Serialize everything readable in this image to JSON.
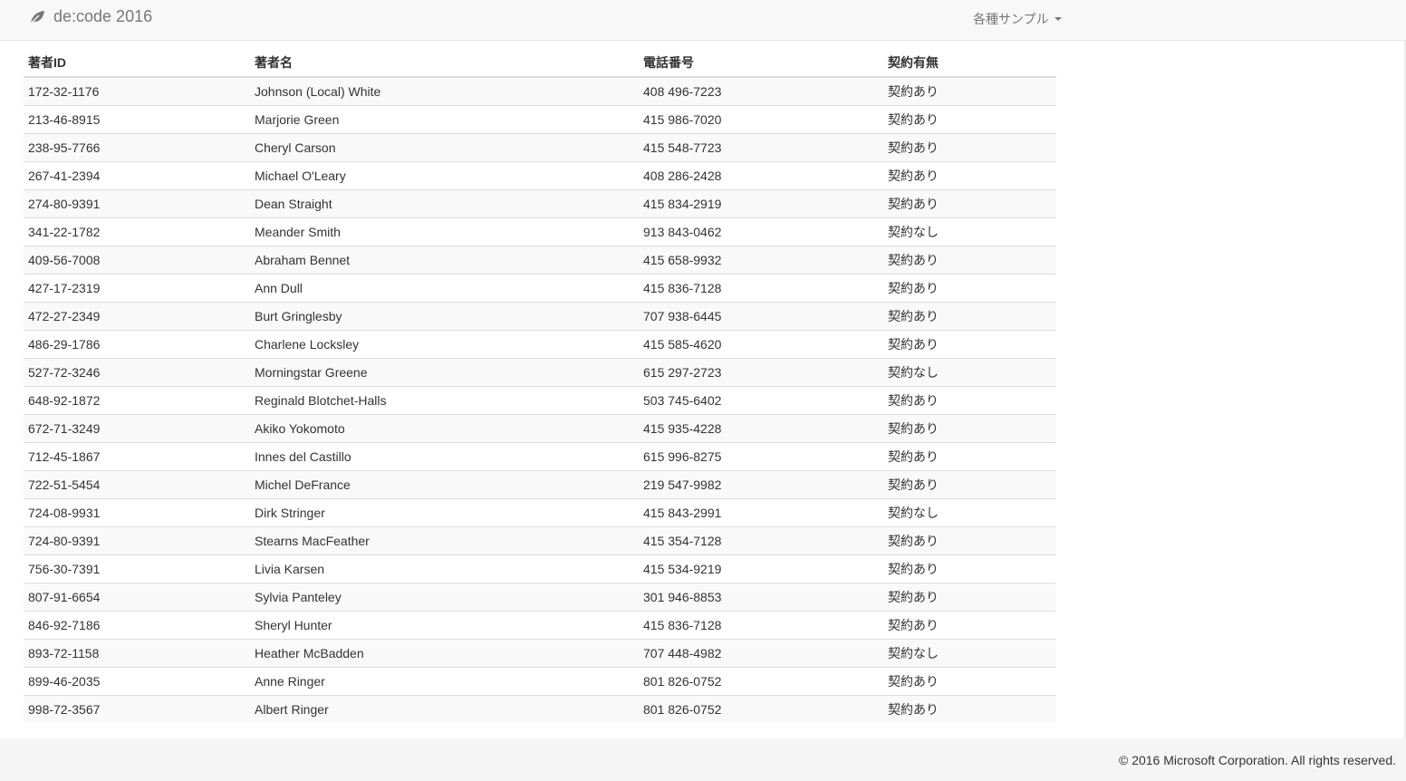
{
  "navbar": {
    "brand": "de:code 2016",
    "brand_icon": "leaf-icon",
    "dropdown_label": "各種サンプル"
  },
  "table": {
    "headers": [
      "著者ID",
      "著者名",
      "電話番号",
      "契約有無"
    ],
    "rows": [
      [
        "172-32-1176",
        "Johnson (Local) White",
        "408 496-7223",
        "契約あり"
      ],
      [
        "213-46-8915",
        "Marjorie Green",
        "415 986-7020",
        "契約あり"
      ],
      [
        "238-95-7766",
        "Cheryl Carson",
        "415 548-7723",
        "契約あり"
      ],
      [
        "267-41-2394",
        "Michael O'Leary",
        "408 286-2428",
        "契約あり"
      ],
      [
        "274-80-9391",
        "Dean Straight",
        "415 834-2919",
        "契約あり"
      ],
      [
        "341-22-1782",
        "Meander Smith",
        "913 843-0462",
        "契約なし"
      ],
      [
        "409-56-7008",
        "Abraham Bennet",
        "415 658-9932",
        "契約あり"
      ],
      [
        "427-17-2319",
        "Ann Dull",
        "415 836-7128",
        "契約あり"
      ],
      [
        "472-27-2349",
        "Burt Gringlesby",
        "707 938-6445",
        "契約あり"
      ],
      [
        "486-29-1786",
        "Charlene Locksley",
        "415 585-4620",
        "契約あり"
      ],
      [
        "527-72-3246",
        "Morningstar Greene",
        "615 297-2723",
        "契約なし"
      ],
      [
        "648-92-1872",
        "Reginald Blotchet-Halls",
        "503 745-6402",
        "契約あり"
      ],
      [
        "672-71-3249",
        "Akiko Yokomoto",
        "415 935-4228",
        "契約あり"
      ],
      [
        "712-45-1867",
        "Innes del Castillo",
        "615 996-8275",
        "契約あり"
      ],
      [
        "722-51-5454",
        "Michel DeFrance",
        "219 547-9982",
        "契約あり"
      ],
      [
        "724-08-9931",
        "Dirk Stringer",
        "415 843-2991",
        "契約なし"
      ],
      [
        "724-80-9391",
        "Stearns MacFeather",
        "415 354-7128",
        "契約あり"
      ],
      [
        "756-30-7391",
        "Livia Karsen",
        "415 534-9219",
        "契約あり"
      ],
      [
        "807-91-6654",
        "Sylvia Panteley",
        "301 946-8853",
        "契約あり"
      ],
      [
        "846-92-7186",
        "Sheryl Hunter",
        "415 836-7128",
        "契約あり"
      ],
      [
        "893-72-1158",
        "Heather McBadden",
        "707 448-4982",
        "契約なし"
      ],
      [
        "899-46-2035",
        "Anne Ringer",
        "801 826-0752",
        "契約あり"
      ],
      [
        "998-72-3567",
        "Albert Ringer",
        "801 826-0752",
        "契約あり"
      ]
    ]
  },
  "footer": {
    "copyright": "© 2016 Microsoft Corporation. All rights reserved."
  }
}
